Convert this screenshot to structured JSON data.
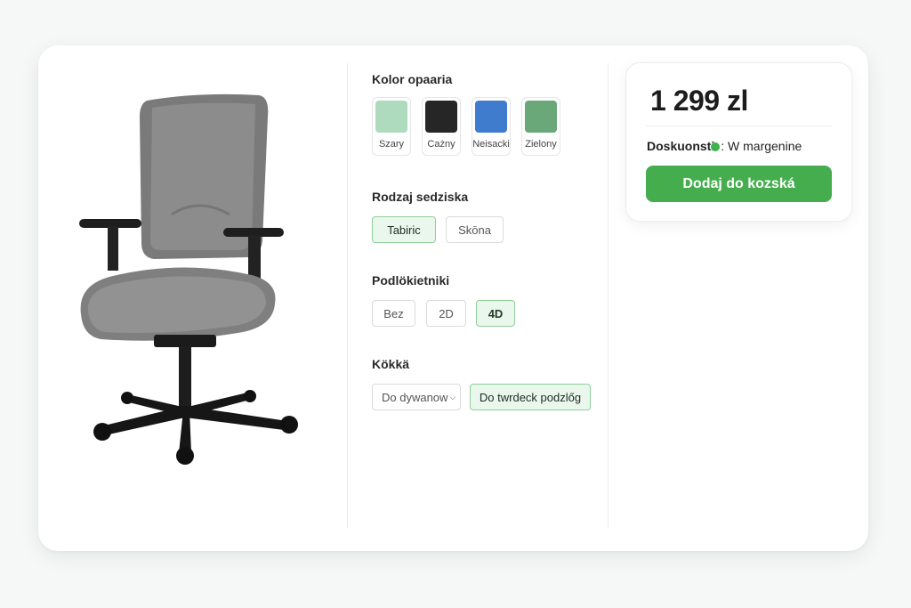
{
  "product": {
    "image_alt": "ergonomic-office-chair"
  },
  "options": {
    "color": {
      "title": "Kolor opaaria",
      "swatches": [
        {
          "label": "Szary",
          "color": "#aedbbe"
        },
        {
          "label": "Cażny",
          "color": "#262626"
        },
        {
          "label": "Neisacki",
          "color": "#3f7ccd"
        },
        {
          "label": "Zielony",
          "color": "#6aa87a"
        }
      ]
    },
    "seat": {
      "title": "Rodzaj sedziska",
      "choices": [
        "Tabiric",
        "Skōna"
      ],
      "selected": "Tabiric"
    },
    "armrests": {
      "title": "Podlökietniki",
      "choices": [
        "Bez",
        "2D",
        "4D"
      ],
      "selected": "4D"
    },
    "wheels": {
      "title": "Kökkä",
      "dropdown_value": "Do dywanow",
      "alt_choice": "Do twrdeck podzlőg"
    }
  },
  "purchase": {
    "price": "1 299 zl",
    "availability_label": "Doskuonsti",
    "availability_value": ": W margenine",
    "status_color": "#3cb34b",
    "add_to_cart": "Dodaj do kozská",
    "accent": "#46ad4f"
  }
}
